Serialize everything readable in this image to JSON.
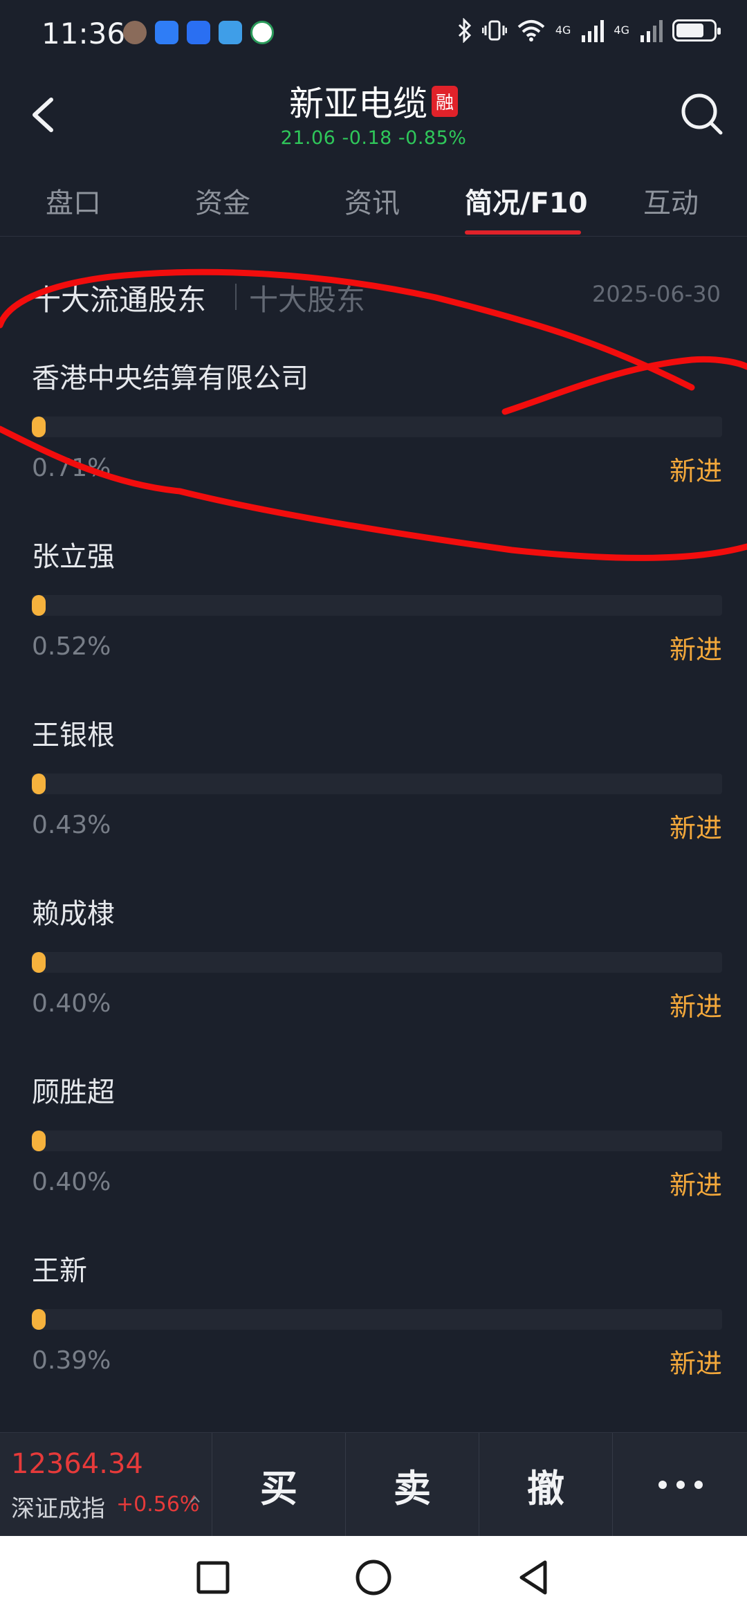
{
  "status_bar": {
    "time": "11:36",
    "network_1": "4G",
    "network_2": "4G",
    "battery_level": 0.75
  },
  "header": {
    "title": "新亚电缆",
    "badge": "融",
    "price": "21.06",
    "change": "-0.18",
    "change_pct": "-0.85%",
    "price_color": "#2fc75a"
  },
  "tabs": [
    {
      "label": "盘口"
    },
    {
      "label": "资金"
    },
    {
      "label": "资讯"
    },
    {
      "label": "简况/F10",
      "active": true
    },
    {
      "label": "互动"
    }
  ],
  "section": {
    "title": "十大流通股东",
    "alt_title": "十大股东",
    "date": "2025-06-30"
  },
  "holders": [
    {
      "name": "香港中央结算有限公司",
      "pct": "0.71%",
      "tag": "新进",
      "share": 0.71
    },
    {
      "name": "张立强",
      "pct": "0.52%",
      "tag": "新进",
      "share": 0.52
    },
    {
      "name": "王银根",
      "pct": "0.43%",
      "tag": "新进",
      "share": 0.43
    },
    {
      "name": "赖成棣",
      "pct": "0.40%",
      "tag": "新进",
      "share": 0.4
    },
    {
      "name": "顾胜超",
      "pct": "0.40%",
      "tag": "新进",
      "share": 0.4
    },
    {
      "name": "王新",
      "pct": "0.39%",
      "tag": "新进",
      "share": 0.39
    }
  ],
  "bottom_bar": {
    "index_value": "12364.34",
    "index_name": "深证成指",
    "index_change": "+0.56%",
    "buy": "买",
    "sell": "卖",
    "cancel": "撤"
  },
  "colors": {
    "background": "#1b202b",
    "accent_red": "#e0222a",
    "bar_fill": "#f6b23d",
    "tag": "#f3a83b"
  }
}
